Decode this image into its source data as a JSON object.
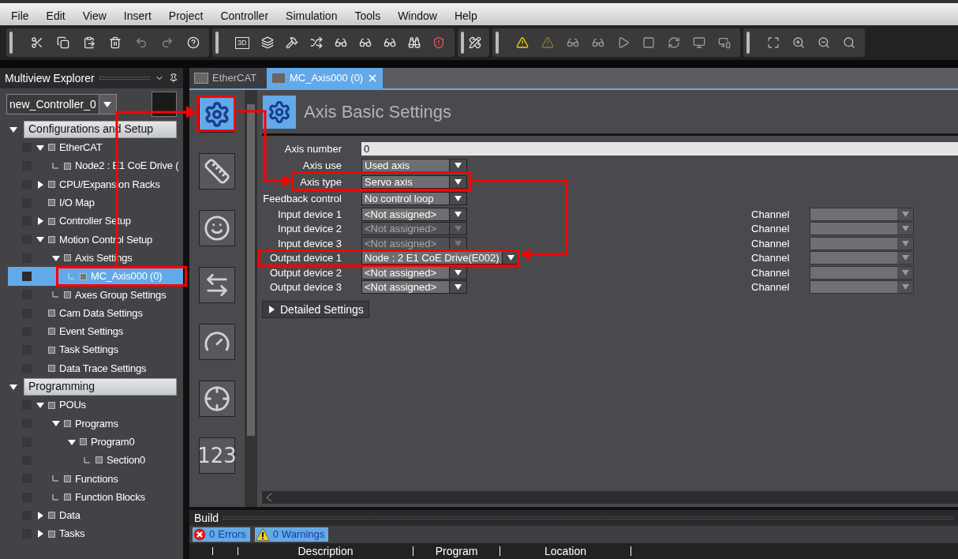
{
  "menu": [
    "File",
    "Edit",
    "View",
    "Insert",
    "Project",
    "Controller",
    "Simulation",
    "Tools",
    "Window",
    "Help"
  ],
  "toolbar": {
    "badge": "3D"
  },
  "explorer": {
    "title": "Multiview Explorer",
    "controller": "new_Controller_0",
    "tree": [
      {
        "kind": "section",
        "label": "Configurations and Setup",
        "expanded": true,
        "selected": false,
        "children": [
          {
            "kind": "item",
            "label": "EtherCAT",
            "expanded": true,
            "selected": false,
            "children": [
              {
                "kind": "item",
                "label": "Node2 : E1 CoE Drive (",
                "connector": true,
                "selected": false
              }
            ]
          },
          {
            "kind": "item",
            "label": "CPU/Expansion Racks",
            "expanded": false,
            "selected": false
          },
          {
            "kind": "item",
            "label": "I/O Map",
            "selected": false
          },
          {
            "kind": "item",
            "label": "Controller Setup",
            "expanded": false,
            "selected": false
          },
          {
            "kind": "item",
            "label": "Motion Control Setup",
            "expanded": true,
            "selected": false,
            "children": [
              {
                "kind": "item",
                "label": "Axis Settings",
                "expanded": true,
                "selected": false,
                "children": [
                  {
                    "kind": "item",
                    "label": "MC_Axis000 (0)",
                    "connector": true,
                    "selected": true
                  }
                ]
              },
              {
                "kind": "item",
                "label": "Axes Group Settings",
                "connector": true,
                "selected": false
              }
            ]
          },
          {
            "kind": "item",
            "label": "Cam Data Settings",
            "selected": false
          },
          {
            "kind": "item",
            "label": "Event Settings",
            "selected": false
          },
          {
            "kind": "item",
            "label": "Task Settings",
            "selected": false
          },
          {
            "kind": "item",
            "label": "Data Trace Settings",
            "selected": false
          }
        ]
      },
      {
        "kind": "section",
        "label": "Programming",
        "expanded": true,
        "selected": false,
        "children": [
          {
            "kind": "item",
            "label": "POUs",
            "expanded": true,
            "selected": false,
            "children": [
              {
                "kind": "item",
                "label": "Programs",
                "expanded": true,
                "selected": false,
                "children": [
                  {
                    "kind": "item",
                    "label": "Program0",
                    "expanded": true,
                    "selected": false,
                    "children": [
                      {
                        "kind": "item",
                        "label": "Section0",
                        "connector": true,
                        "selected": false
                      }
                    ]
                  }
                ]
              },
              {
                "kind": "item",
                "label": "Functions",
                "connector": true,
                "selected": false
              },
              {
                "kind": "item",
                "label": "Function Blocks",
                "connector": true,
                "selected": false
              }
            ]
          },
          {
            "kind": "item",
            "label": "Data",
            "expanded": false,
            "selected": false
          },
          {
            "kind": "item",
            "label": "Tasks",
            "expanded": false,
            "selected": false
          }
        ]
      }
    ]
  },
  "tabs": [
    {
      "label": "EtherCAT",
      "selected": false,
      "closable": false
    },
    {
      "label": "MC_Axis000 (0)",
      "selected": true,
      "closable": true
    }
  ],
  "editor": {
    "side_buttons": [
      {
        "kind": "settings",
        "selected": true
      },
      {
        "kind": "units",
        "selected": false
      },
      {
        "kind": "operation",
        "selected": false
      },
      {
        "kind": "transfer",
        "selected": false
      },
      {
        "kind": "limits",
        "selected": false
      },
      {
        "kind": "position",
        "selected": false
      },
      {
        "kind": "numeric",
        "label": "123",
        "selected": false
      }
    ],
    "title": "Axis Basic Settings",
    "fields": [
      {
        "label": "Axis number",
        "kind": "text",
        "value": "0"
      },
      {
        "label": "Axis use",
        "kind": "select",
        "value": "Used axis",
        "disabled": false
      },
      {
        "label": "Axis type",
        "kind": "select",
        "value": "Servo axis",
        "disabled": false
      },
      {
        "label": "Feedback control",
        "kind": "select",
        "value": "No control loop",
        "disabled": false
      },
      {
        "label": "Input device 1",
        "kind": "select",
        "value": "<Not assigned>",
        "disabled": false,
        "channel": "Channel"
      },
      {
        "label": "Input device 2",
        "kind": "select",
        "value": "<Not assigned>",
        "disabled": true,
        "channel": "Channel"
      },
      {
        "label": "Input device 3",
        "kind": "select",
        "value": "<Not assigned>",
        "disabled": true,
        "channel": "Channel"
      },
      {
        "label": "Output device 1",
        "kind": "select",
        "value": "Node : 2 E1 CoE Drive(E002)",
        "disabled": false,
        "channel": "Channel"
      },
      {
        "label": "Output device 2",
        "kind": "select",
        "value": "<Not assigned>",
        "disabled": false,
        "channel": "Channel"
      },
      {
        "label": "Output device 3",
        "kind": "select",
        "value": "<Not assigned>",
        "disabled": false,
        "channel": "Channel"
      }
    ],
    "detailed": {
      "label": "Detailed Settings",
      "expanded": false
    }
  },
  "build": {
    "title": "Build",
    "errors": {
      "count": "0",
      "label": "Errors"
    },
    "warnings": {
      "count": "0",
      "label": "Warnings"
    },
    "columns": [
      "Description",
      "Program",
      "Location"
    ]
  }
}
